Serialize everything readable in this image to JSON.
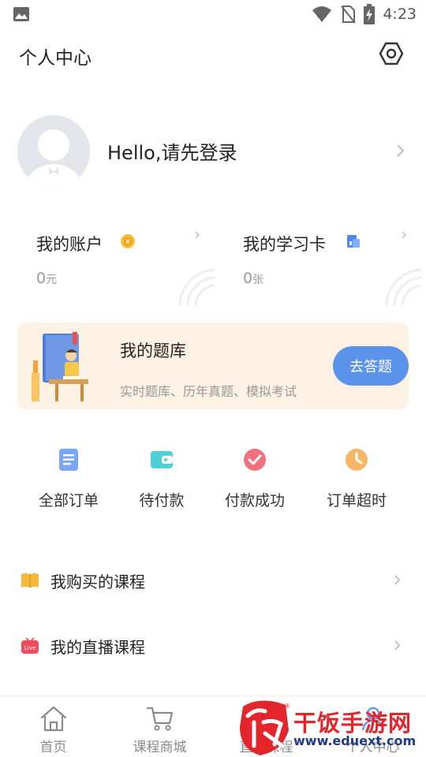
{
  "status_bar": {
    "time": "4:23"
  },
  "header": {
    "title": "个人中心"
  },
  "profile": {
    "greeting": "Hello,请先登录"
  },
  "account_card": {
    "title": "我的账户",
    "value": "0",
    "unit": "元"
  },
  "study_card": {
    "title": "我的学习卡",
    "value": "0",
    "unit": "张"
  },
  "question_bank": {
    "title": "我的题库",
    "subtitle": "实时题库、历年真题、模拟考试",
    "button_label": "去答题"
  },
  "orders": [
    {
      "label": "全部订单",
      "icon": "document-icon",
      "color": "#5b8ef0"
    },
    {
      "label": "待付款",
      "icon": "wallet-icon",
      "color": "#3dc3c9"
    },
    {
      "label": "付款成功",
      "icon": "check-circle-icon",
      "color": "#f25a6c"
    },
    {
      "label": "订单超时",
      "icon": "clock-icon",
      "color": "#f5a64a"
    }
  ],
  "menu": [
    {
      "label": "我购买的课程",
      "icon": "open-book-icon"
    },
    {
      "label": "我的直播课程",
      "icon": "live-tv-icon",
      "icon_text": "Live"
    }
  ],
  "tabs": [
    {
      "label": "首页",
      "icon": "home-icon"
    },
    {
      "label": "课程商城",
      "icon": "cart-icon"
    },
    {
      "label": "直播课程",
      "icon": "live-icon"
    },
    {
      "label": "个人中心",
      "icon": "person-icon"
    }
  ],
  "watermark": {
    "brand": "干饭手游网",
    "url": "www.eduext.com",
    "logo_text": "饭"
  },
  "colors": {
    "accent": "#5b93ea",
    "banner_bg": "#fdf1e4",
    "watermark_red": "#e2262b",
    "watermark_blue": "#1d3a8c"
  }
}
